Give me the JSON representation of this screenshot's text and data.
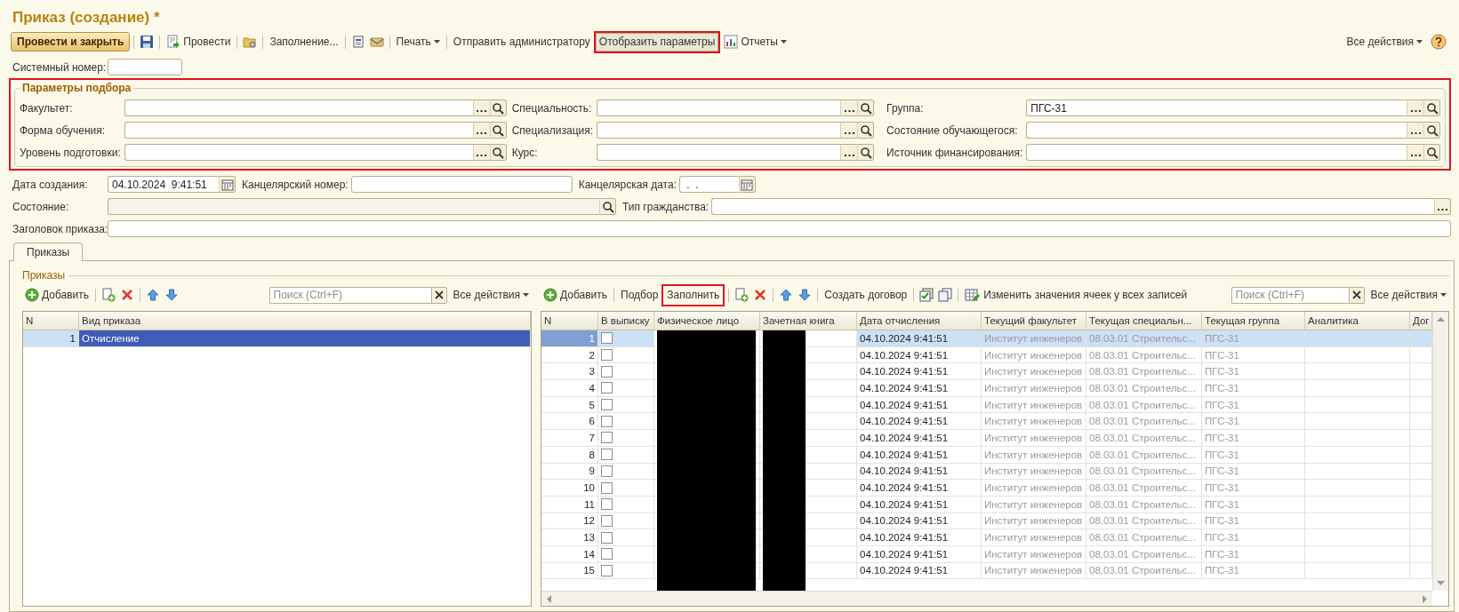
{
  "window": {
    "title": "Приказ (создание) *"
  },
  "toolbar": {
    "items": [
      {
        "kind": "primary",
        "label": "Провести и закрыть",
        "highlighted": false
      },
      {
        "kind": "separator"
      },
      {
        "kind": "icon",
        "highlighted": false
      },
      {
        "kind": "separator"
      },
      {
        "kind": "icon_button",
        "label": "Провести",
        "highlighted": false
      },
      {
        "kind": "separator"
      },
      {
        "kind": "icon",
        "highlighted": false
      },
      {
        "kind": "separator"
      },
      {
        "kind": "button",
        "label": "Заполнение...",
        "highlighted": false
      },
      {
        "kind": "separator"
      },
      {
        "kind": "icon",
        "highlighted": false
      },
      {
        "kind": "icon",
        "highlighted": false
      },
      {
        "kind": "separator"
      },
      {
        "kind": "menu",
        "label": "Печать",
        "highlighted": false
      },
      {
        "kind": "separator"
      },
      {
        "kind": "button",
        "label": "Отправить администратору",
        "highlighted": false
      },
      {
        "kind": "toggle",
        "label": "Отобразить параметры",
        "on": true,
        "highlighted": true
      },
      {
        "kind": "icon_menu",
        "label": "Отчеты",
        "highlighted": false
      }
    ],
    "right_items": [
      {
        "kind": "menu",
        "label": "Все действия",
        "highlighted": false
      },
      {
        "kind": "icon",
        "highlighted": false
      }
    ]
  },
  "system_number": {
    "label": "Системный номер:"
  },
  "selection_params": {
    "title": "Параметры подбора",
    "highlighted": true,
    "fields": [
      {
        "label": "Факультет:"
      },
      {
        "label": "Специальность:"
      },
      {
        "label": "Группа:",
        "value": "ПГС-31"
      },
      {
        "label": "Форма обучения:"
      },
      {
        "label": "Специализация:"
      },
      {
        "label": "Состояние обучающегося:"
      },
      {
        "label": "Уровень подготовки:"
      },
      {
        "label": "Курс:"
      },
      {
        "label": "Источник финансирования:"
      }
    ]
  },
  "header_rows": [
    [
      {
        "label": "Дата создания:",
        "value": "04.10.2024  9:41:51",
        "kind": "date"
      },
      {
        "label": "Канцелярский номер:",
        "kind": "text"
      },
      {
        "label": "Канцелярская дата:",
        "value": " .  .",
        "kind": "date"
      }
    ],
    [
      {
        "label": "Состояние:",
        "kind": "lookup"
      },
      {
        "label": "Тип гражданства:",
        "kind": "choice"
      }
    ],
    [
      {
        "label": "Заголовок приказа:",
        "kind": "text"
      }
    ]
  ],
  "tabs": [
    {
      "label": "Приказы",
      "selected": true
    }
  ],
  "group_title": "Приказы",
  "order_types": {
    "toolbar": {
      "items": [
        {
          "kind": "icon_button",
          "label": "Добавить",
          "highlighted": false
        },
        {
          "kind": "separator"
        },
        {
          "kind": "icon",
          "highlighted": false
        },
        {
          "kind": "icon",
          "highlighted": false
        },
        {
          "kind": "separator"
        },
        {
          "kind": "icon",
          "highlighted": false
        },
        {
          "kind": "icon",
          "highlighted": false
        }
      ],
      "search": {
        "placeholder": "Поиск (Ctrl+F)"
      },
      "right_items": [
        {
          "kind": "menu",
          "label": "Все действия",
          "highlighted": false
        }
      ]
    },
    "columns": [
      {
        "label": "N"
      },
      {
        "label": "Вид приказа"
      }
    ],
    "rows": [
      {
        "n": "1",
        "type": "Отчисление",
        "selected": true
      }
    ]
  },
  "students": {
    "toolbar": {
      "items": [
        {
          "kind": "icon_button",
          "label": "Добавить",
          "highlighted": false
        },
        {
          "kind": "separator"
        },
        {
          "kind": "button",
          "label": "Подбор",
          "highlighted": false
        },
        {
          "kind": "button",
          "label": "Заполнить",
          "highlighted": true
        },
        {
          "kind": "separator"
        },
        {
          "kind": "icon",
          "highlighted": false
        },
        {
          "kind": "icon",
          "highlighted": false
        },
        {
          "kind": "separator"
        },
        {
          "kind": "icon",
          "highlighted": false
        },
        {
          "kind": "icon",
          "highlighted": false
        },
        {
          "kind": "separator"
        },
        {
          "kind": "button",
          "label": "Создать договор",
          "highlighted": false
        },
        {
          "kind": "separator"
        },
        {
          "kind": "icon",
          "highlighted": false
        },
        {
          "kind": "icon",
          "highlighted": false
        },
        {
          "kind": "separator"
        },
        {
          "kind": "icon_button",
          "label": "Изменить значения ячеек у всех записей",
          "highlighted": false
        }
      ],
      "search": {
        "placeholder": "Поиск (Ctrl+F)"
      },
      "right_items": [
        {
          "kind": "menu",
          "label": "Все действия",
          "highlighted": false
        }
      ]
    },
    "columns": [
      {
        "label": "N",
        "kind": "plain"
      },
      {
        "label": "В выписку",
        "kind": "plain"
      },
      {
        "label": "Физическое лицо",
        "kind": "redacted"
      },
      {
        "label": "Зачетная книга",
        "kind": "redacted"
      },
      {
        "label": "Дата отчисления",
        "kind": "plain"
      },
      {
        "label": "Текущий факультет",
        "kind": "inactive"
      },
      {
        "label": "Текущая специальн...",
        "kind": "inactive"
      },
      {
        "label": "Текущая группа",
        "kind": "inactive"
      },
      {
        "label": "Аналитика",
        "kind": "plain"
      },
      {
        "label": "Дог",
        "kind": "plain"
      }
    ],
    "rows": [
      {
        "n": "1",
        "in_extract": false,
        "dismissal_date": "04.10.2024 9:41:51",
        "faculty": "Институт инженеров",
        "specialty": "08.03.01 Строительс...",
        "group": "ПГС-31",
        "selected": true
      },
      {
        "n": "2",
        "in_extract": false,
        "dismissal_date": "04.10.2024 9:41:51",
        "faculty": "Институт инженеров",
        "specialty": "08.03.01 Строительс...",
        "group": "ПГС-31",
        "selected": false
      },
      {
        "n": "3",
        "in_extract": false,
        "dismissal_date": "04.10.2024 9:41:51",
        "faculty": "Институт инженеров",
        "specialty": "08.03.01 Строительс...",
        "group": "ПГС-31",
        "selected": false
      },
      {
        "n": "4",
        "in_extract": false,
        "dismissal_date": "04.10.2024 9:41:51",
        "faculty": "Институт инженеров",
        "specialty": "08.03.01 Строительс...",
        "group": "ПГС-31",
        "selected": false
      },
      {
        "n": "5",
        "in_extract": false,
        "dismissal_date": "04.10.2024 9:41:51",
        "faculty": "Институт инженеров",
        "specialty": "08.03.01 Строительс...",
        "group": "ПГС-31",
        "selected": false
      },
      {
        "n": "6",
        "in_extract": false,
        "dismissal_date": "04.10.2024 9:41:51",
        "faculty": "Институт инженеров",
        "specialty": "08.03.01 Строительс...",
        "group": "ПГС-31",
        "selected": false
      },
      {
        "n": "7",
        "in_extract": false,
        "dismissal_date": "04.10.2024 9:41:51",
        "faculty": "Институт инженеров",
        "specialty": "08.03.01 Строительс...",
        "group": "ПГС-31",
        "selected": false
      },
      {
        "n": "8",
        "in_extract": false,
        "dismissal_date": "04.10.2024 9:41:51",
        "faculty": "Институт инженеров",
        "specialty": "08.03.01 Строительс...",
        "group": "ПГС-31",
        "selected": false
      },
      {
        "n": "9",
        "in_extract": false,
        "dismissal_date": "04.10.2024 9:41:51",
        "faculty": "Институт инженеров",
        "specialty": "08.03.01 Строительс...",
        "group": "ПГС-31",
        "selected": false
      },
      {
        "n": "10",
        "in_extract": false,
        "dismissal_date": "04.10.2024 9:41:51",
        "faculty": "Институт инженеров",
        "specialty": "08.03.01 Строительс...",
        "group": "ПГС-31",
        "selected": false
      },
      {
        "n": "11",
        "in_extract": false,
        "dismissal_date": "04.10.2024 9:41:51",
        "faculty": "Институт инженеров",
        "specialty": "08.03.01 Строительс...",
        "group": "ПГС-31",
        "selected": false
      },
      {
        "n": "12",
        "in_extract": false,
        "dismissal_date": "04.10.2024 9:41:51",
        "faculty": "Институт инженеров",
        "specialty": "08.03.01 Строительс...",
        "group": "ПГС-31",
        "selected": false
      },
      {
        "n": "13",
        "in_extract": false,
        "dismissal_date": "04.10.2024 9:41:51",
        "faculty": "Институт инженеров",
        "specialty": "08.03.01 Строительс...",
        "group": "ПГС-31",
        "selected": false
      },
      {
        "n": "14",
        "in_extract": false,
        "dismissal_date": "04.10.2024 9:41:51",
        "faculty": "Институт инженеров",
        "specialty": "08.03.01 Строительс...",
        "group": "ПГС-31",
        "selected": false
      },
      {
        "n": "15",
        "in_extract": false,
        "dismissal_date": "04.10.2024 9:41:51",
        "faculty": "Институт инженеров",
        "specialty": "08.03.01 Строительс...",
        "group": "ПГС-31",
        "selected": false
      }
    ]
  }
}
